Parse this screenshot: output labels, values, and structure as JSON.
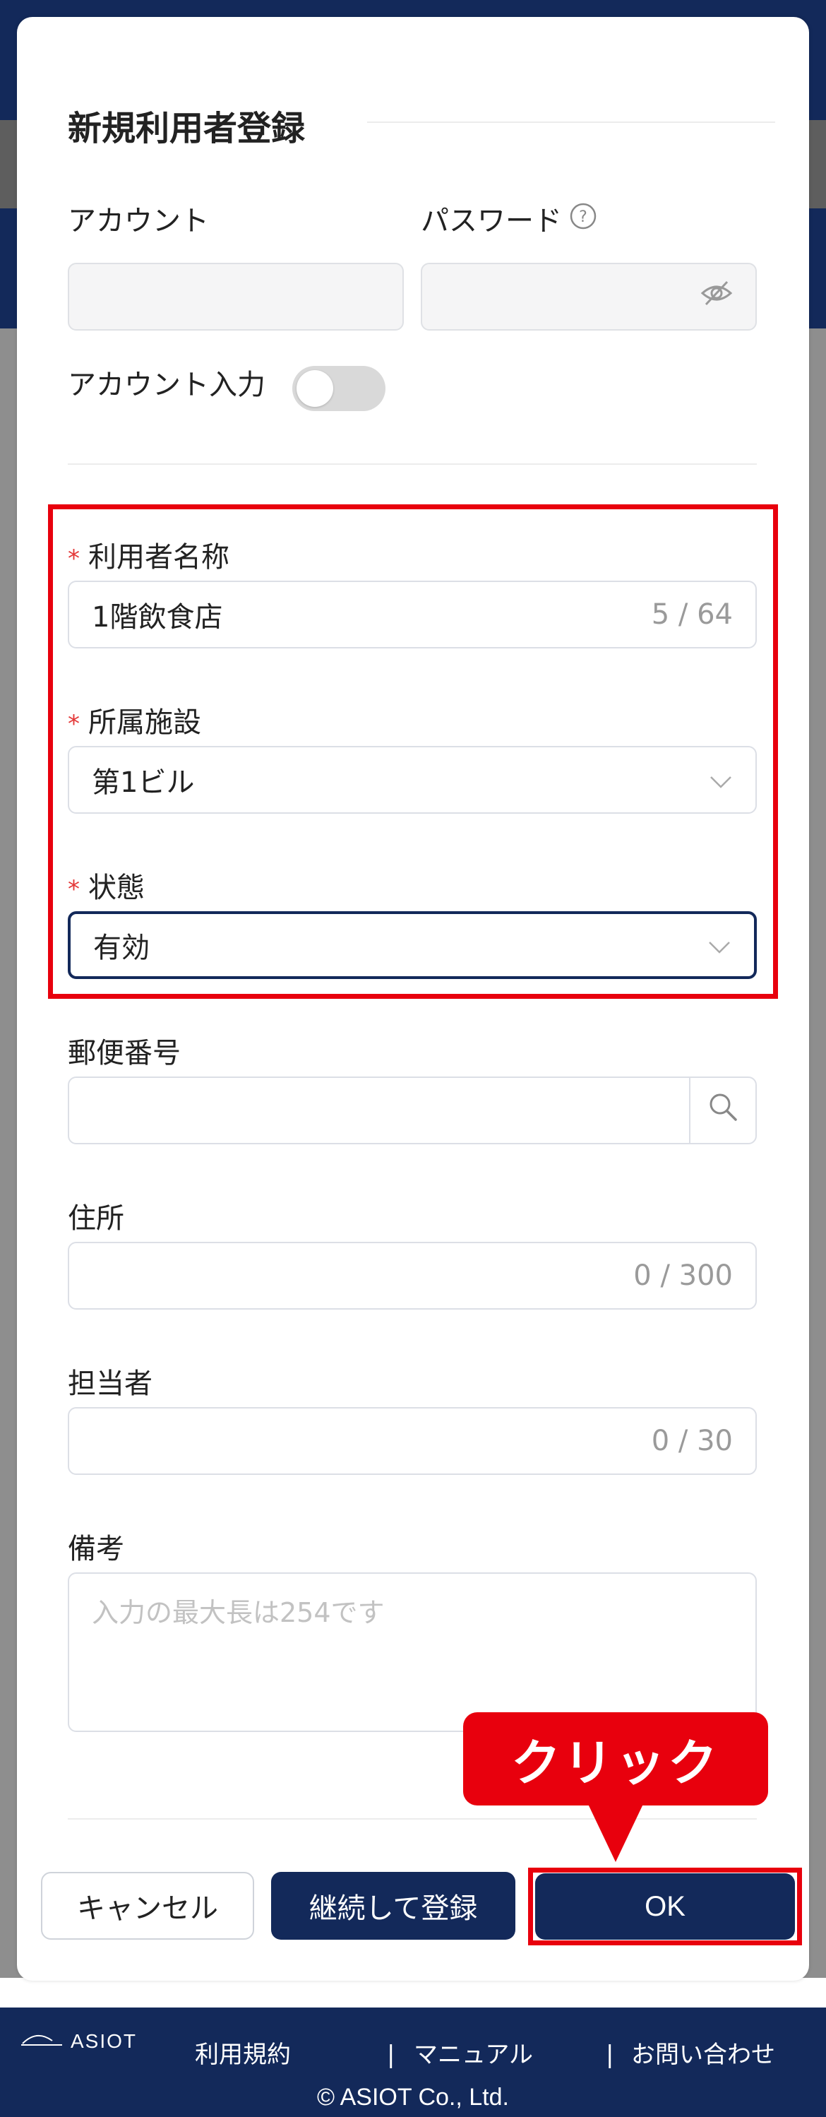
{
  "form": {
    "title": "新規利用者登録",
    "account_label": "アカウント",
    "account_value": "",
    "password_label": "パスワード",
    "password_value": "",
    "account_input_label": "アカウント入力",
    "account_input_enabled": false,
    "user_name_label": "利用者名称",
    "user_name_value": "1階飲食店",
    "user_name_counter": "5 / 64",
    "facility_label": "所属施設",
    "facility_value": "第1ビル",
    "status_label": "状態",
    "status_value": "有効",
    "postal_label": "郵便番号",
    "postal_value": "",
    "address_label": "住所",
    "address_value": "",
    "address_counter": "0 / 300",
    "person_label": "担当者",
    "person_value": "",
    "person_counter": "0 / 30",
    "notes_label": "備考",
    "notes_placeholder": "入力の最大長は254です",
    "required_mark": "*"
  },
  "buttons": {
    "cancel": "キャンセル",
    "continue": "継続して登録",
    "ok": "OK"
  },
  "annotation": {
    "callout": "クリック",
    "color": "#e8000d"
  },
  "footer": {
    "logo": "ASIOT",
    "links": [
      "利用規約",
      "マニュアル",
      "お問い合わせ"
    ],
    "separator": "|",
    "copyright": "© ASIOT Co., Ltd."
  },
  "colors": {
    "primary": "#13295a",
    "required": "#e43838",
    "counter": "#9a9a9a"
  }
}
